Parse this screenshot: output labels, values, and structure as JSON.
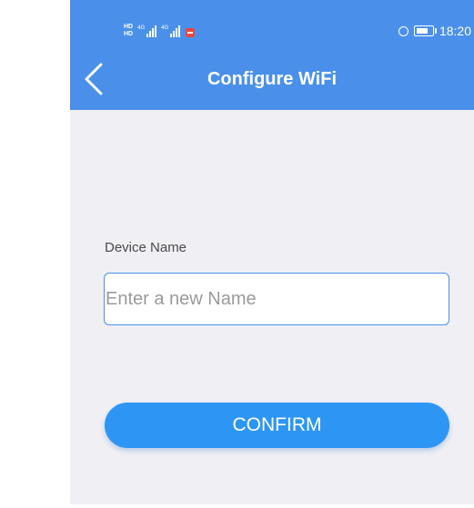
{
  "colors": {
    "header": "#4a90ea",
    "background": "#f0eff4",
    "button": "#2d96f4",
    "input_border": "#4a90ea"
  },
  "status_bar": {
    "hd_badge": "HD",
    "network_type": "4G",
    "time": "18:20",
    "icons": [
      "hd-icon",
      "signal-icon",
      "alert-icon",
      "alarm-icon",
      "battery-icon"
    ]
  },
  "header": {
    "back_icon": "chevron-left-icon",
    "title": "Configure WiFi"
  },
  "form": {
    "device_name_label": "Device Name",
    "device_name_placeholder": "Enter a new Name",
    "device_name_value": ""
  },
  "confirm_button": {
    "label": "CONFIRM"
  }
}
